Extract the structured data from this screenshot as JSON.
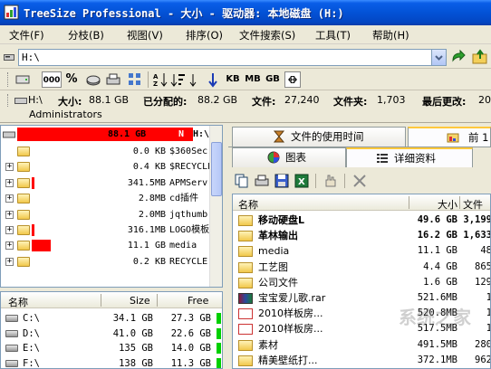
{
  "title_bar": {
    "title": "TreeSize Professional - 大小 - 驱动器: 本地磁盘 (H:)"
  },
  "menu": [
    {
      "label": "文件(F)"
    },
    {
      "label": "分枝(B)"
    },
    {
      "label": "视图(V)"
    },
    {
      "label": "排序(O)"
    },
    {
      "label": "文件搜索(S)"
    },
    {
      "label": "工具(T)"
    },
    {
      "label": "帮助(H)"
    }
  ],
  "address": {
    "value": "H:\\"
  },
  "toolbar": {
    "kb": "KB",
    "mb": "MB",
    "gb": "GB",
    "count": "000",
    "percent": "%"
  },
  "summary": {
    "drive": "H:\\",
    "owner": "Administrators",
    "size_label": "大小:",
    "size_value": "88.1 GB",
    "alloc_label": "已分配的:",
    "alloc_value": "88.2 GB",
    "files_label": "文件:",
    "files_value": "27,240",
    "folders_label": "文件夹:",
    "folders_value": "1,703",
    "modified_label": "最后更改:",
    "modified_value": "20"
  },
  "tree": {
    "root": {
      "size": "88.1 GB",
      "pct": "N",
      "name": "H:\\"
    },
    "rows": [
      {
        "size": "0.0 KB",
        "name": "$360Sec",
        "expand": "",
        "bar": 0
      },
      {
        "size": "0.4 KB",
        "name": "$RECYCLE",
        "expand": "+",
        "bar": 0
      },
      {
        "size": "341.5MB",
        "name": "APMServ",
        "expand": "+",
        "bar": 0.02
      },
      {
        "size": "2.8MB",
        "name": "cd插件",
        "expand": "+",
        "bar": 0
      },
      {
        "size": "2.0MB",
        "name": "jqthumb",
        "expand": "+",
        "bar": 0
      },
      {
        "size": "316.1MB",
        "name": "LOGO模板",
        "expand": "+",
        "bar": 0.02
      },
      {
        "size": "11.1 GB",
        "name": "media",
        "expand": "+",
        "bar": 0.13
      },
      {
        "size": "0.2 KB",
        "name": "RECYCLE",
        "expand": "+",
        "bar": 0
      }
    ]
  },
  "drives": {
    "headers": {
      "name": "名称",
      "size": "Size",
      "free": "Free"
    },
    "rows": [
      {
        "name": "C:\\",
        "size": "34.1 GB",
        "free": "27.3 GB"
      },
      {
        "name": "D:\\",
        "size": "41.0 GB",
        "free": "22.6 GB"
      },
      {
        "name": "E:\\",
        "size": "135 GB",
        "free": "14.0 GB"
      },
      {
        "name": "F:\\",
        "size": "138 GB",
        "free": "11.3 GB"
      }
    ]
  },
  "tabs": {
    "top": [
      {
        "label": "文件的使用时间"
      },
      {
        "label": "前 1"
      }
    ],
    "sub": [
      {
        "label": "图表"
      },
      {
        "label": "详细资料"
      }
    ]
  },
  "list": {
    "headers": {
      "name": "名称",
      "size": "大小",
      "files": "文件"
    },
    "rows": [
      {
        "icon": "folder-icon",
        "name": "移动硬盘L",
        "size": "49.6 GB",
        "files": "3,199",
        "bold": true
      },
      {
        "icon": "folder-icon",
        "name": "革林输出",
        "size": "16.2 GB",
        "files": "1,633",
        "bold": true
      },
      {
        "icon": "folder-icon",
        "name": "media",
        "size": "11.1 GB",
        "files": "48",
        "bold": false
      },
      {
        "icon": "folder-icon",
        "name": "工艺图",
        "size": "4.4 GB",
        "files": "865",
        "bold": false
      },
      {
        "icon": "folder-icon",
        "name": "公司文件",
        "size": "1.6 GB",
        "files": "129",
        "bold": false
      },
      {
        "icon": "rar-icon",
        "name": "宝宝爱儿歌.rar",
        "size": "521.6MB",
        "files": "1",
        "bold": false
      },
      {
        "icon": "pdf-icon",
        "name": "2010样板房...",
        "size": "520.8MB",
        "files": "1",
        "bold": false
      },
      {
        "icon": "pdf-icon",
        "name": "2010样板房...",
        "size": "517.5MB",
        "files": "1",
        "bold": false
      },
      {
        "icon": "folder-icon",
        "name": "素材",
        "size": "491.5MB",
        "files": "280",
        "bold": false
      },
      {
        "icon": "folder-icon",
        "name": "精美壁纸打...",
        "size": "372.1MB",
        "files": "962",
        "bold": false
      }
    ]
  },
  "watermark": "系统之家"
}
